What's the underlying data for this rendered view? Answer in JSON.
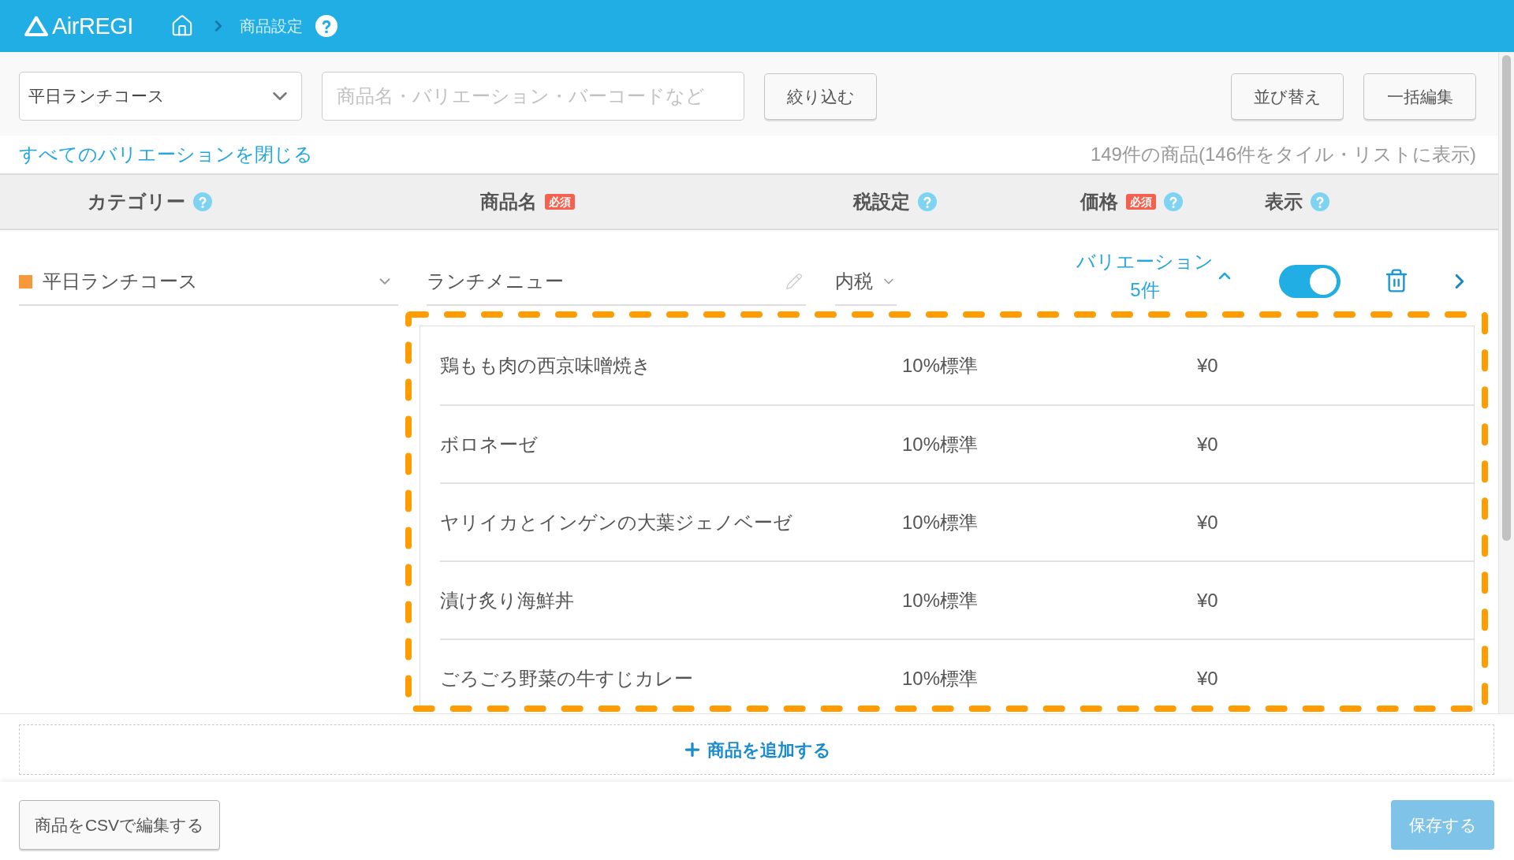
{
  "header": {
    "logo": "AirREGI",
    "breadcrumb": "商品設定"
  },
  "toolbar": {
    "category_select": {
      "value": "平日ランチコース"
    },
    "search": {
      "placeholder": "商品名・バリエーション・バーコードなど"
    },
    "filter_button": "絞り込む",
    "actions": [
      "並び替え",
      "一括編集"
    ]
  },
  "list_bar": {
    "collapse_link": "すべてのバリエーションを閉じる",
    "count": "149件の商品(146件をタイル・リストに表示)"
  },
  "table": {
    "columns": [
      {
        "label": "カテゴリー",
        "help": true
      },
      {
        "label": "商品名",
        "badge": "必須",
        "help": false
      },
      {
        "label": "税設定",
        "help": true
      },
      {
        "label": "価格",
        "badge": "必須",
        "help": true
      },
      {
        "label": "表示",
        "help": true
      }
    ],
    "rows": [
      {
        "category": "平日ランチコース",
        "color": "#f7993a",
        "name": "ランチメニュー",
        "tax": "内税",
        "variation_label": "バリエーション",
        "variation_count": "5件",
        "expanded": true,
        "visible": true,
        "highlighted": true,
        "variations": [
          {
            "name": "鶏もも肉の西京味噌焼き",
            "tax": "10%標準",
            "price": "¥0"
          },
          {
            "name": "ボロネーゼ",
            "tax": "10%標準",
            "price": "¥0"
          },
          {
            "name": "ヤリイカとインゲンの大葉ジェノベーゼ",
            "tax": "10%標準",
            "price": "¥0"
          },
          {
            "name": "漬け炙り海鮮丼",
            "tax": "10%標準",
            "price": "¥0"
          },
          {
            "name": "ごろごろ野菜の牛すじカレー",
            "tax": "10%標準",
            "price": "¥0"
          }
        ]
      }
    ]
  },
  "add_button": "商品を追加する",
  "footer": {
    "csv_button": "商品をCSVで編集する",
    "save_button": {
      "label": "保存する",
      "disabled": true
    }
  }
}
